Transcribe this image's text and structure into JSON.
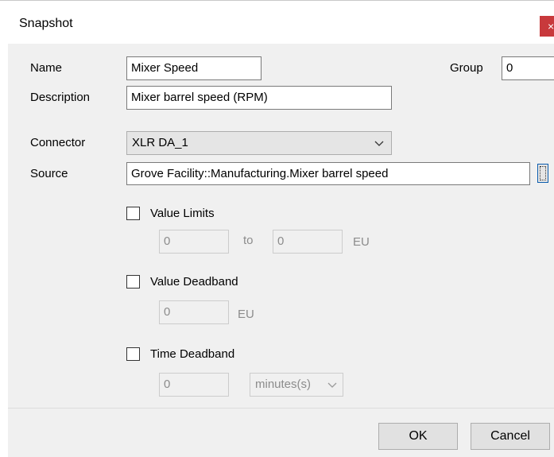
{
  "window": {
    "title": "Snapshot",
    "close_glyph": "×"
  },
  "form": {
    "name_label": "Name",
    "name_value": "Mixer Speed",
    "group_label": "Group",
    "group_value": "0",
    "description_label": "Description",
    "description_value": "Mixer barrel speed (RPM)",
    "connector_label": "Connector",
    "connector_value": "XLR DA_1",
    "source_label": "Source",
    "source_value": "Grove Facility::Manufacturing.Mixer barrel speed"
  },
  "value_limits": {
    "label": "Value Limits",
    "checked": false,
    "min_value": "0",
    "to_label": "to",
    "max_value": "0",
    "unit": "EU"
  },
  "value_deadband": {
    "label": "Value Deadband",
    "checked": false,
    "value": "0",
    "unit": "EU"
  },
  "time_deadband": {
    "label": "Time Deadband",
    "checked": false,
    "value": "0",
    "unit_value": "minutes(s)"
  },
  "buttons": {
    "ok": "OK",
    "cancel": "Cancel"
  },
  "icons": {
    "close": "close-icon",
    "dropdown": "chevron-down-icon",
    "browse": "browse-icon"
  },
  "colors": {
    "close_button": "#c8393c",
    "dialog_background": "#f0f0f0",
    "focus_border": "#0a5cad"
  }
}
